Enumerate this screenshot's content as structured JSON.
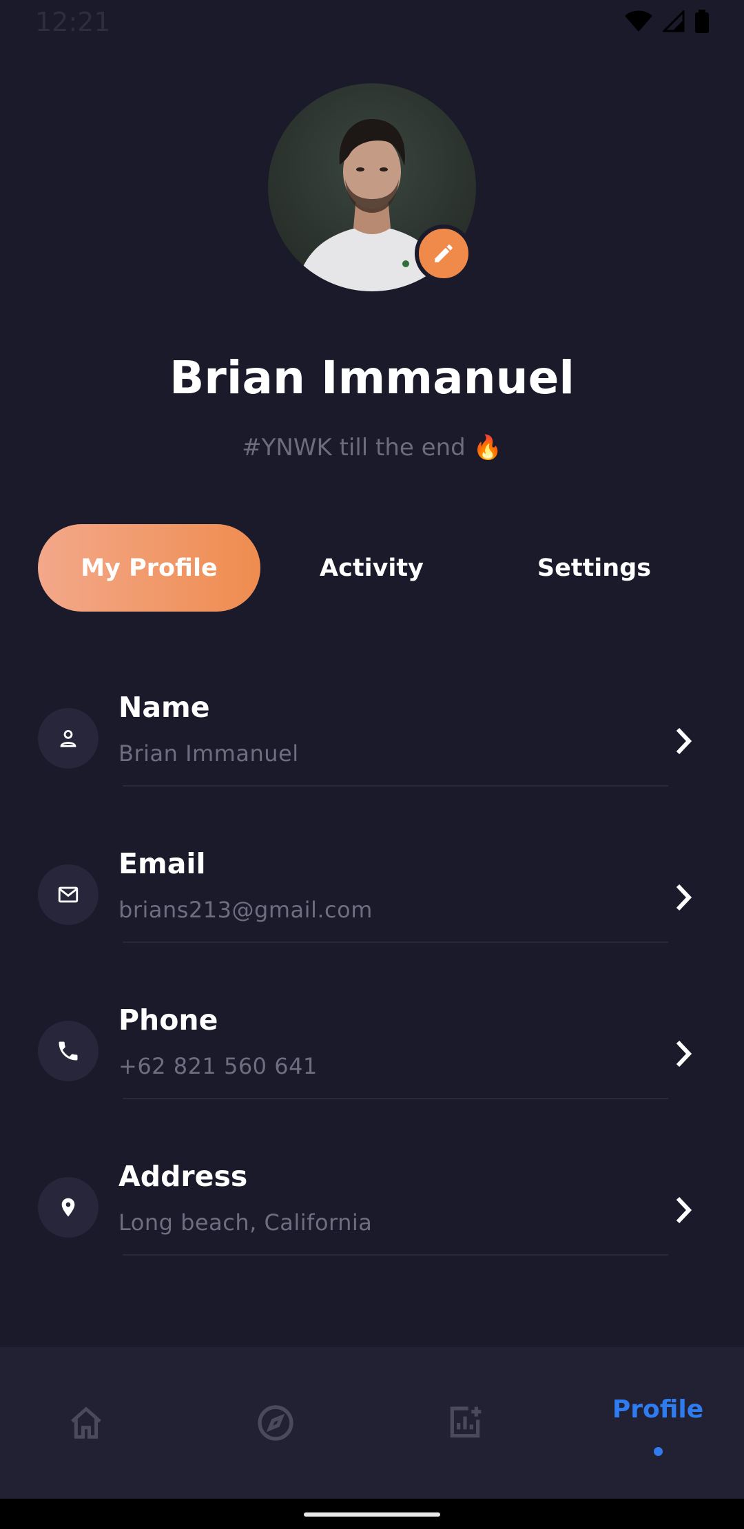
{
  "status_bar": {
    "time": "12:21"
  },
  "profile": {
    "name": "Brian Immanuel",
    "bio": "#YNWK till the end 🔥"
  },
  "tabs": [
    {
      "label": "My Profile",
      "active": true
    },
    {
      "label": "Activity",
      "active": false
    },
    {
      "label": "Settings",
      "active": false
    }
  ],
  "details": [
    {
      "label": "Name",
      "value": "Brian Immanuel",
      "icon": "person-icon"
    },
    {
      "label": "Email",
      "value": "brians213@gmail.com",
      "icon": "mail-icon"
    },
    {
      "label": "Phone",
      "value": "+62 821 560 641",
      "icon": "phone-icon"
    },
    {
      "label": "Address",
      "value": "Long beach, California",
      "icon": "location-pin-icon"
    }
  ],
  "bottom_nav": {
    "items": [
      {
        "icon": "home-icon"
      },
      {
        "icon": "compass-icon"
      },
      {
        "icon": "stats-add-icon"
      },
      {
        "label": "Profile",
        "active": true
      }
    ]
  },
  "colors": {
    "background": "#1b1a2a",
    "accent_orange": "#ef8c4f",
    "accent_blue": "#2f7bf0",
    "muted_text": "#6f6d80"
  }
}
